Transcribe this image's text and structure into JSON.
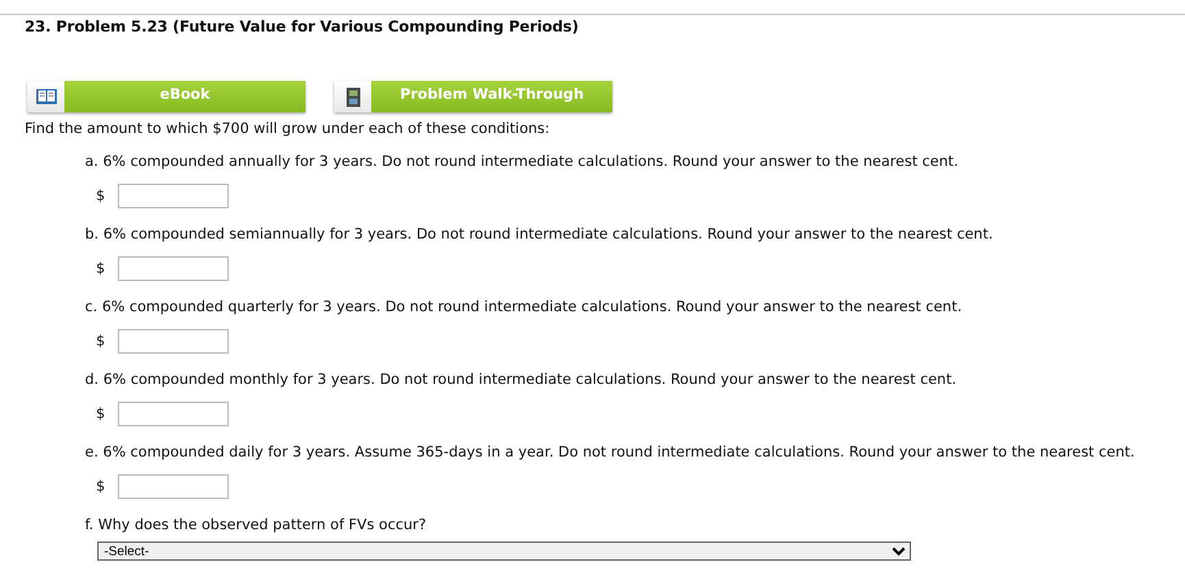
{
  "title": "23.  Problem 5.23 (Future Value for Various Compounding Periods)",
  "resource_buttons": [
    {
      "label": "eBook",
      "kind": "book"
    },
    {
      "label": "Problem Walk-Through",
      "kind": "film"
    }
  ],
  "instruction": "Find the amount to which $700 will grow under each of these conditions:",
  "questions": [
    {
      "kind": "amount",
      "text": "a. 6% compounded annually for 3 years. Do not round intermediate calculations. Round your answer to the nearest cent.",
      "currency": "$"
    },
    {
      "kind": "amount",
      "text": "b. 6% compounded semiannually for 3 years. Do not round intermediate calculations. Round your answer to the nearest cent.",
      "currency": "$"
    },
    {
      "kind": "amount",
      "text": "c. 6% compounded quarterly for 3 years. Do not round intermediate calculations. Round your answer to the nearest cent.",
      "currency": "$"
    },
    {
      "kind": "amount",
      "text": "d. 6% compounded monthly for 3 years. Do not round intermediate calculations. Round your answer to the nearest cent.",
      "currency": "$"
    },
    {
      "kind": "amount",
      "text": "e. 6% compounded daily for 3 years. Assume 365-days in a year. Do not round intermediate calculations. Round your answer to the nearest cent.",
      "currency": "$"
    },
    {
      "kind": "choice",
      "text": "f. Why does the observed pattern of FVs occur?",
      "value": "-Select-"
    }
  ]
}
